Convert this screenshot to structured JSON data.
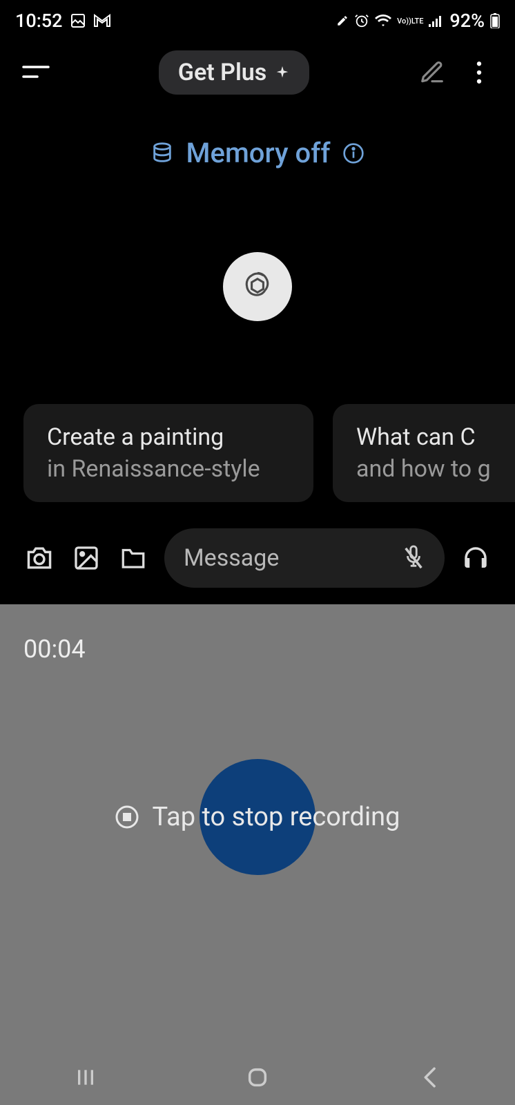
{
  "status": {
    "time": "10:52",
    "battery": "92%",
    "network_label": "LTE",
    "vo_label": "Vo))"
  },
  "header": {
    "get_plus_label": "Get Plus"
  },
  "memory_banner": {
    "label": "Memory off"
  },
  "suggestions": [
    {
      "line1": "Create a painting",
      "line2": "in Renaissance-style"
    },
    {
      "line1": "What can C",
      "line2": "and how to g"
    }
  ],
  "input": {
    "placeholder": "Message"
  },
  "recording": {
    "timer": "00:04",
    "label": "Tap to stop recording"
  }
}
